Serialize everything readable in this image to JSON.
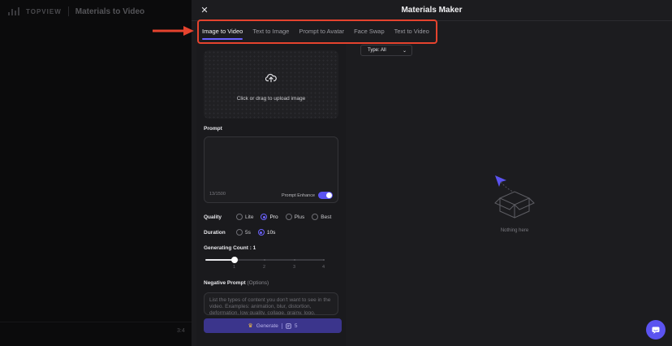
{
  "background": {
    "brand": "TOPVIEW",
    "title": "Materials to Video",
    "ratio": "3:4"
  },
  "modal": {
    "title": "Materials Maker",
    "close_icon": "close-icon"
  },
  "tabs": [
    {
      "label": "Image to Video",
      "active": true
    },
    {
      "label": "Text to Image",
      "active": false
    },
    {
      "label": "Prompt to Avatar",
      "active": false
    },
    {
      "label": "Face Swap",
      "active": false
    },
    {
      "label": "Text to Video",
      "active": false
    }
  ],
  "annotation": {
    "highlight_color": "#e5432e"
  },
  "upload": {
    "icon": "cloud-upload-icon",
    "text": "Click or drag to upload image"
  },
  "prompt": {
    "label": "Prompt",
    "value": "",
    "count": "13/1500",
    "enhance_label": "Prompt Enhance",
    "enhance_on": true
  },
  "quality": {
    "label": "Quality",
    "options": [
      "Lite",
      "Pro",
      "Plus",
      "Best"
    ],
    "selected": "Pro"
  },
  "duration": {
    "label": "Duration",
    "options": [
      "5s",
      "10s"
    ],
    "selected": "10s"
  },
  "generating_count": {
    "label": "Generating Count : 1",
    "ticks": [
      "1",
      "2",
      "3",
      "4"
    ],
    "value": 1,
    "min": 1,
    "max": 4
  },
  "negative_prompt": {
    "label": "Negative Prompt",
    "label_suffix": "(Options)",
    "placeholder": "List the types of content you don't want to see in the video. Examples: animation, blur, distortion, deformation, low quality, collage, grainy, logo, abstract, illustration, computer generated, distorted"
  },
  "generate": {
    "label": "Generate",
    "cost": "5",
    "crown_icon": "crown-icon",
    "credit_icon": "credit-icon"
  },
  "filter": {
    "label": "Type: All",
    "icon": "chevron-down-icon"
  },
  "empty_state": {
    "icon": "empty-box-icon",
    "text": "Nothing here"
  },
  "chat": {
    "icon": "chat-icon"
  },
  "colors": {
    "accent": "#6c63ff",
    "generate_bg": "#3b358c",
    "annotation": "#e5432e"
  }
}
